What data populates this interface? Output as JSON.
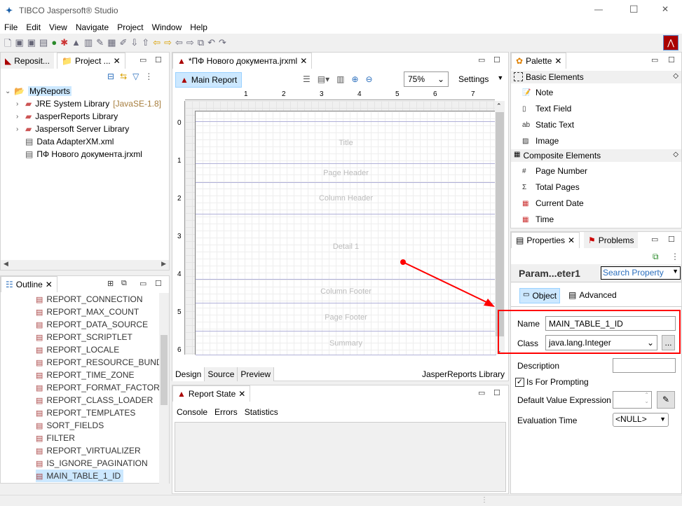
{
  "window": {
    "title": "TIBCO Jaspersoft® Studio",
    "minimize": "—",
    "maximize": "☐",
    "close": "✕"
  },
  "menu": [
    "File",
    "Edit",
    "View",
    "Navigate",
    "Project",
    "Window",
    "Help"
  ],
  "left": {
    "tabs": [
      "Reposit...",
      "Project ..."
    ],
    "tree": [
      {
        "label": "MyReports",
        "level": 0
      },
      {
        "label": "JRE System Library",
        "extra": "[JavaSE-1.8]",
        "level": 1
      },
      {
        "label": "JasperReports Library",
        "level": 1
      },
      {
        "label": "Jaspersoft Server Library",
        "level": 1
      },
      {
        "label": "Data AdapterXM.xml",
        "level": 1
      },
      {
        "label": "ПФ Нового документа.jrxml",
        "level": 1
      }
    ],
    "outline_tab": "Outline",
    "outline": [
      "REPORT_CONNECTION",
      "REPORT_MAX_COUNT",
      "REPORT_DATA_SOURCE",
      "REPORT_SCRIPTLET",
      "REPORT_LOCALE",
      "REPORT_RESOURCE_BUNDLE",
      "REPORT_TIME_ZONE",
      "REPORT_FORMAT_FACTORY",
      "REPORT_CLASS_LOADER",
      "REPORT_TEMPLATES",
      "SORT_FIELDS",
      "FILTER",
      "REPORT_VIRTUALIZER",
      "IS_IGNORE_PAGINATION",
      "MAIN_TABLE_1_ID"
    ]
  },
  "editor": {
    "tab": "*ПФ Нового документа.jrxml",
    "main_report": "Main Report",
    "zoom": "75%",
    "settings": "Settings",
    "ruler": [
      "1",
      "2",
      "3",
      "4",
      "5",
      "6",
      "7"
    ],
    "vruler": [
      "0",
      "1",
      "2",
      "3",
      "4",
      "5",
      "6"
    ],
    "bands": [
      "Title",
      "Page Header",
      "Column Header",
      "Detail 1",
      "Column Footer",
      "Page Footer",
      "Summary"
    ],
    "bottom_tabs": [
      "Design",
      "Source",
      "Preview"
    ],
    "library": "JasperReports Library"
  },
  "report_state": {
    "tab": "Report State",
    "tabs": [
      "Console",
      "Errors",
      "Statistics"
    ]
  },
  "palette": {
    "tab": "Palette",
    "basic": "Basic Elements",
    "basic_items": [
      "Note",
      "Text Field",
      "Static Text",
      "Image"
    ],
    "composite": "Composite Elements",
    "composite_items": [
      "Page Number",
      "Total Pages",
      "Current Date",
      "Time"
    ]
  },
  "properties": {
    "tab": "Properties",
    "problems_tab": "Problems",
    "title": "Param...eter1",
    "search_placeholder": "Search Property",
    "object_tab": "Object",
    "advanced_tab": "Advanced",
    "name_label": "Name",
    "name_value": "MAIN_TABLE_1_ID",
    "class_label": "Class",
    "class_value": "java.lang.Integer",
    "browse": "...",
    "description_label": "Description",
    "prompting_label": "Is For Prompting",
    "prompting_checked": true,
    "default_label": "Default Value Expression",
    "eval_label": "Evaluation Time",
    "eval_value": "<NULL>"
  },
  "colors": {
    "highlight": "#ff0000",
    "selection": "#cce8ff"
  }
}
